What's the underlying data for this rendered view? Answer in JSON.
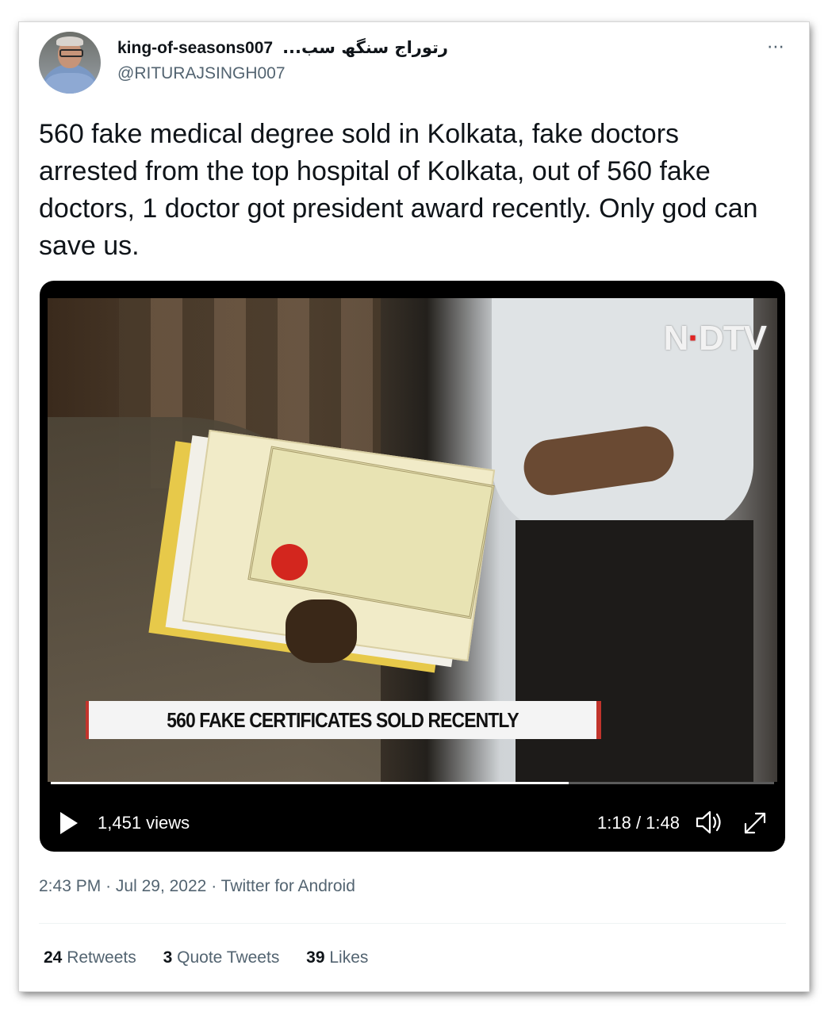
{
  "author": {
    "display_name": "king-of-seasons007",
    "display_name_urdu": "رتوراج سنگھ سب...",
    "handle": "@RITURAJSINGH007"
  },
  "more_icon": "⋯",
  "tweet": {
    "text": "560 fake medical degree sold in Kolkata, fake doctors arrested from the top hospital of Kolkata, out of 560 fake doctors, 1 doctor got president award recently. Only god can save us."
  },
  "video": {
    "channel_logo_left": "N",
    "channel_logo_dot": "·",
    "channel_logo_right": "DTV",
    "caption": "560 FAKE CERTIFICATES SOLD RECENTLY",
    "views": "1,451 views",
    "time": "1:18 / 1:48",
    "progress": 0.716,
    "icons": [
      "play-icon",
      "volume-icon",
      "fullscreen-icon"
    ]
  },
  "meta": {
    "time": "2:43 PM",
    "date": "Jul 29, 2022",
    "source": "Twitter for Android",
    "separator": "·"
  },
  "stats": {
    "retweets_count": "24",
    "retweets_label": "Retweets",
    "quotes_count": "3",
    "quotes_label": "Quote Tweets",
    "likes_count": "39",
    "likes_label": "Likes"
  },
  "colors": {
    "text_primary": "#0f1419",
    "text_secondary": "#536471",
    "ndtv_red": "#e12525"
  }
}
